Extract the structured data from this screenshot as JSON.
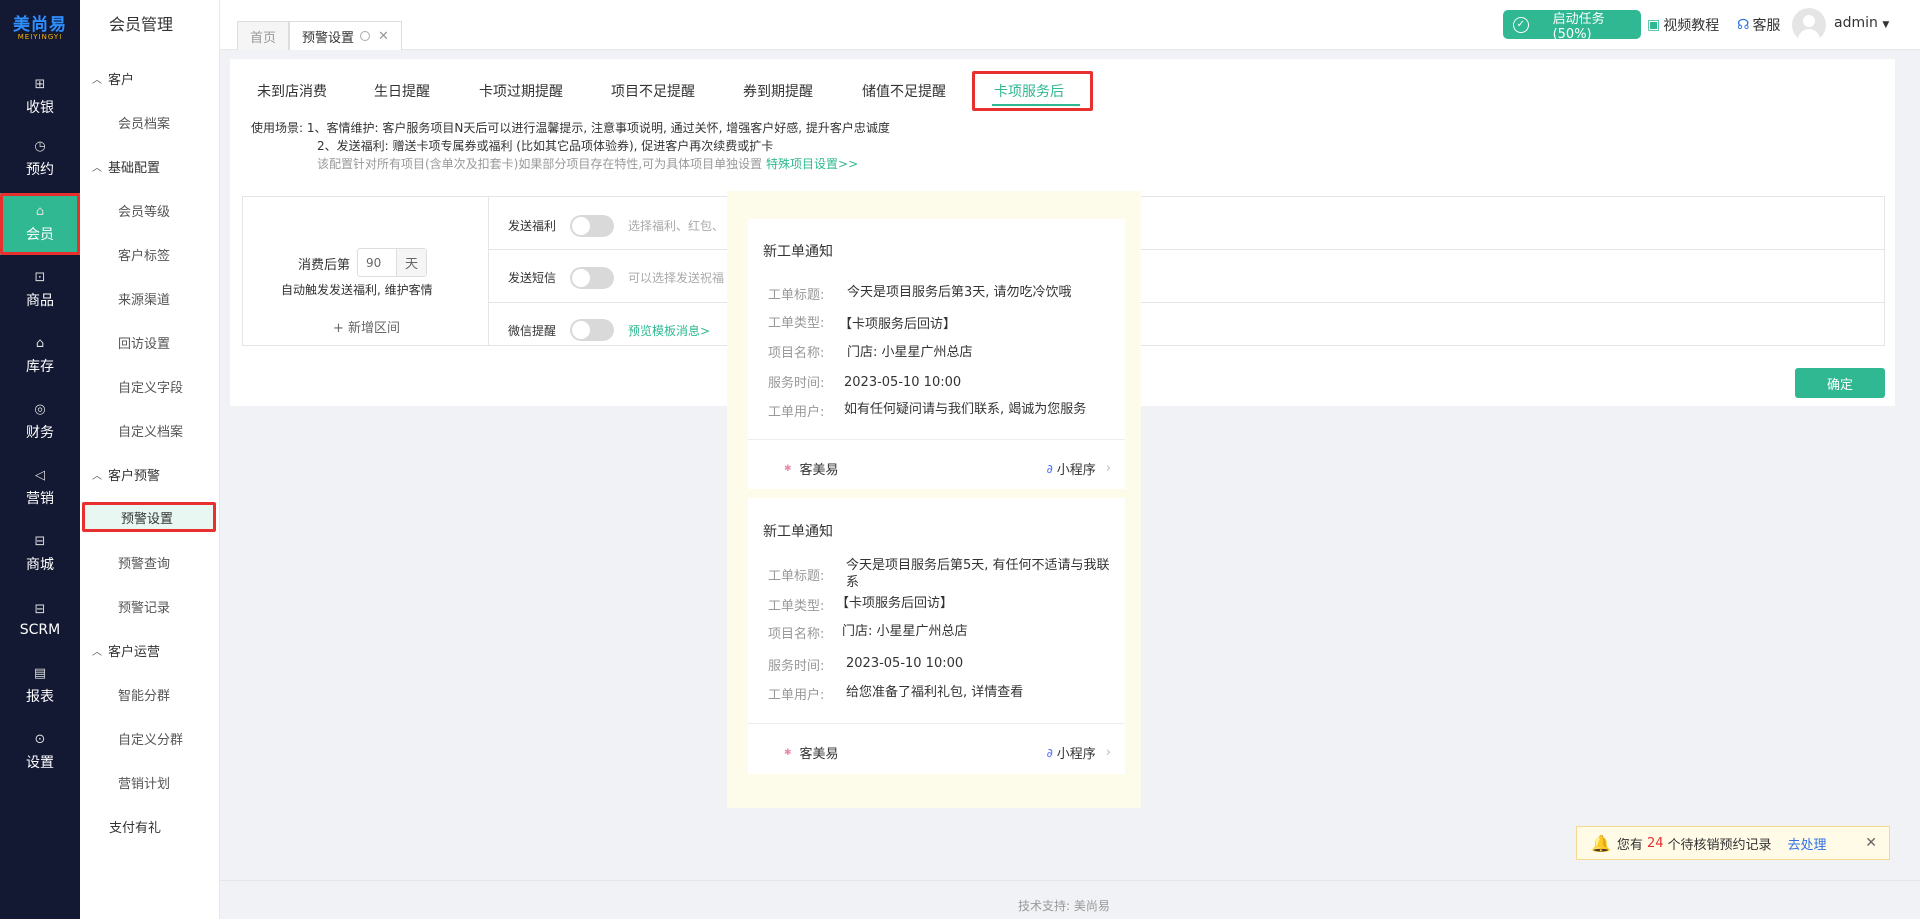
{
  "brand": {
    "logo_cn": "美尚易",
    "logo_en": "MEIYINGYI"
  },
  "nav": [
    {
      "label": "收银",
      "icon": "cashier-icon",
      "glyph": "⊞"
    },
    {
      "label": "预约",
      "icon": "clock-icon",
      "glyph": "◷"
    },
    {
      "label": "会员",
      "icon": "member-icon",
      "glyph": "⌂"
    },
    {
      "label": "商品",
      "icon": "bag-icon",
      "glyph": "⊡"
    },
    {
      "label": "库存",
      "icon": "warehouse-icon",
      "glyph": "⌂"
    },
    {
      "label": "财务",
      "icon": "wallet-icon",
      "glyph": "◎"
    },
    {
      "label": "营销",
      "icon": "megaphone-icon",
      "glyph": "◁"
    },
    {
      "label": "商城",
      "icon": "store-icon",
      "glyph": "⊟"
    },
    {
      "label": "SCRM",
      "icon": "scrm-icon",
      "glyph": "⊟"
    },
    {
      "label": "报表",
      "icon": "report-icon",
      "glyph": "▤"
    },
    {
      "label": "设置",
      "icon": "settings-icon",
      "glyph": "⊙"
    }
  ],
  "subnav": {
    "title": "会员管理",
    "groups": [
      {
        "label": "客户",
        "items": [
          "会员档案"
        ]
      },
      {
        "label": "基础配置",
        "items": [
          "会员等级",
          "客户标签",
          "来源渠道",
          "回访设置",
          "自定义字段",
          "自定义档案"
        ]
      },
      {
        "label": "客户预警",
        "items": [
          "预警设置",
          "预警查询",
          "预警记录"
        ]
      },
      {
        "label": "客户运营",
        "items": [
          "智能分群",
          "自定义分群",
          "营销计划"
        ]
      }
    ],
    "extra": "支付有礼"
  },
  "topbar": {
    "tabs": [
      {
        "label": "首页"
      },
      {
        "label": "预警设置"
      }
    ],
    "task_label": "启动任务(50%)",
    "video_label": "视频教程",
    "service_label": "客服",
    "user": "admin"
  },
  "tabs": [
    "未到店消费",
    "生日提醒",
    "卡项过期提醒",
    "项目不足提醒",
    "券到期提醒",
    "储值不足提醒",
    "卡项服务后"
  ],
  "usage": {
    "prefix": "使用场景:",
    "line1": "1、客情维护: 客户服务项目N天后可以进行温馨提示, 注意事项说明, 通过关怀, 增强客户好感, 提升客户忠诚度",
    "line2": "2、发送福利: 赠送卡项专属券或福利 (比如其它品项体验券), 促进客户再次续费或扩卡",
    "hint": "该配置针对所有项目(含单次及扣套卡)如果部分项目存在特性,可为具体项目单独设置",
    "link": "特殊项目设置>>"
  },
  "config": {
    "after_label": "消费后第",
    "days_value": "90",
    "days_unit": "天",
    "desc": "自动触发发送福利, 维护客情",
    "add_range": "+ 新增区间",
    "send_benefit_label": "发送福利",
    "send_benefit_hint": "选择福利、红包、",
    "send_sms_label": "发送短信",
    "send_sms_hint": "可以选择发送祝福",
    "wechat_label": "微信提醒",
    "wechat_link": "预览模板消息>"
  },
  "confirm_label": "确定",
  "preview": {
    "cards": [
      {
        "title": "新工单通知",
        "rows": [
          {
            "label": "工单标题:",
            "value": "今天是项目服务后第3天, 请勿吃冷饮哦"
          },
          {
            "label": "工单类型:",
            "value": "【卡项服务后回访】"
          },
          {
            "label": "项目名称:",
            "value": "门店: 小星星广州总店"
          },
          {
            "label": "服务时间:",
            "value": "2023-05-10  10:00"
          },
          {
            "label": "工单用户:",
            "value": "如有任何疑问请与我们联系, 竭诚为您服务"
          }
        ],
        "brand": "客美易",
        "mini": "小程序"
      },
      {
        "title": "新工单通知",
        "rows": [
          {
            "label": "工单标题:",
            "value": "今天是项目服务后第5天, 有任何不适请与我联系"
          },
          {
            "label": "工单类型:",
            "value": "【卡项服务后回访】"
          },
          {
            "label": "项目名称:",
            "value": "门店: 小星星广州总店"
          },
          {
            "label": "服务时间:",
            "value": "2023-05-10  10:00"
          },
          {
            "label": "工单用户:",
            "value": "给您准备了福利礼包, 详情查看"
          }
        ],
        "brand": "客美易",
        "mini": "小程序"
      }
    ]
  },
  "notice": {
    "prefix": "您有",
    "count": "24",
    "suffix": "个待核销预约记录",
    "action": "去处理"
  },
  "footer": "技术支持: 美尚易",
  "colors": {
    "accent": "#2fb891",
    "highlight": "#e8312f",
    "nav_bg": "#131833"
  }
}
